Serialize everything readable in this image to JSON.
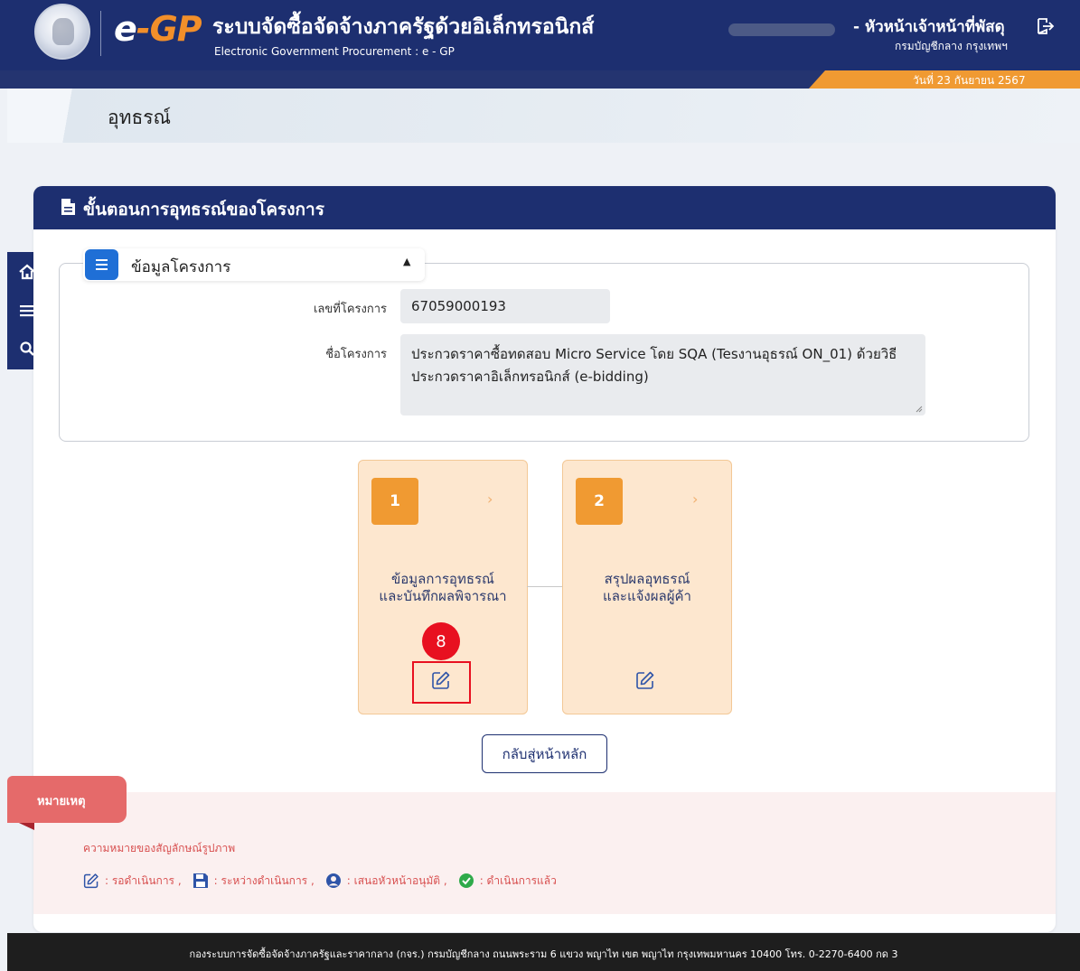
{
  "header": {
    "logo_text_e": "e",
    "logo_text_dash": "-",
    "logo_text_gp": "GP",
    "system_title": "ระบบจัดซื้อจัดจ้างภาครัฐด้วยอิเล็กทรอนิกส์",
    "system_subtitle": "Electronic Government Procurement : e - GP",
    "user_role": "- หัวหน้าเจ้าหน้าที่พัสดุ",
    "user_org": "กรมบัญชีกลาง กรุงเทพฯ",
    "date": "วันที่ 23 กันยายน 2567",
    "icons": {
      "seal": "government-seal-icon",
      "logout": "logout-icon"
    }
  },
  "page": {
    "title": "อุทธรณ์"
  },
  "sidebar": {
    "items": [
      {
        "name": "home",
        "icon": "home-icon"
      },
      {
        "name": "menu",
        "icon": "menu-icon"
      },
      {
        "name": "search",
        "icon": "search-icon"
      }
    ]
  },
  "card": {
    "title": "ขั้นตอนการอุทธรณ์ของโครงการ",
    "icon": "document-icon"
  },
  "project_info": {
    "section_label": "ข้อมูลโครงการ",
    "caret": "▲",
    "project_no_label": "เลขที่โครงการ",
    "project_no_value": "67059000193",
    "project_name_label": "ชื่อโครงการ",
    "project_name_value": "ประกวดราคาซื้อทดสอบ Micro Service โดย SQA (Tesงานอุธรณ์ ON_01)  ด้วยวิธีประกวดราคาอิเล็กทรอนิกส์ (e-bidding)"
  },
  "steps": [
    {
      "number": "1",
      "label_line1": "ข้อมูลการอุทธรณ์",
      "label_line2": "และบันทึกผลพิจารณา",
      "action_icon": "edit-icon"
    },
    {
      "number": "2",
      "label_line1": "สรุปผลอุทธรณ์",
      "label_line2": "และแจ้งผลผู้ค้า",
      "action_icon": "edit-icon"
    }
  ],
  "annotation": {
    "marker_number": "8"
  },
  "back_button": "กลับสู่หน้าหลัก",
  "remarks": {
    "tab_label": "หมายเหตุ",
    "title": "ความหมายของสัญลักษณ์รูปภาพ",
    "legend": [
      {
        "icon": "edit-icon",
        "text": ": รอดำเนินการ ,"
      },
      {
        "icon": "save-icon",
        "text": ": ระหว่างดำเนินการ ,"
      },
      {
        "icon": "user-circle-icon",
        "text": ": เสนอหัวหน้าอนุมัติ ,"
      },
      {
        "icon": "check-circle-icon",
        "text": ": ดำเนินการแล้ว"
      }
    ]
  },
  "footer": {
    "text": "กองระบบการจัดซื้อจัดจ้างภาครัฐและราคากลาง (กจร.) กรมบัญชีกลาง ถนนพระราม 6 แขวง พญาไท เขต พญาไท กรุงเทพมหานคร 10400 โทร. 0-2270-6400 กด 3"
  },
  "colors": {
    "navy": "#1d2f70",
    "orange": "#f09a32",
    "step_bg": "#fde7cf",
    "annotation_red": "#e81020",
    "remark_red": "#d85050"
  }
}
